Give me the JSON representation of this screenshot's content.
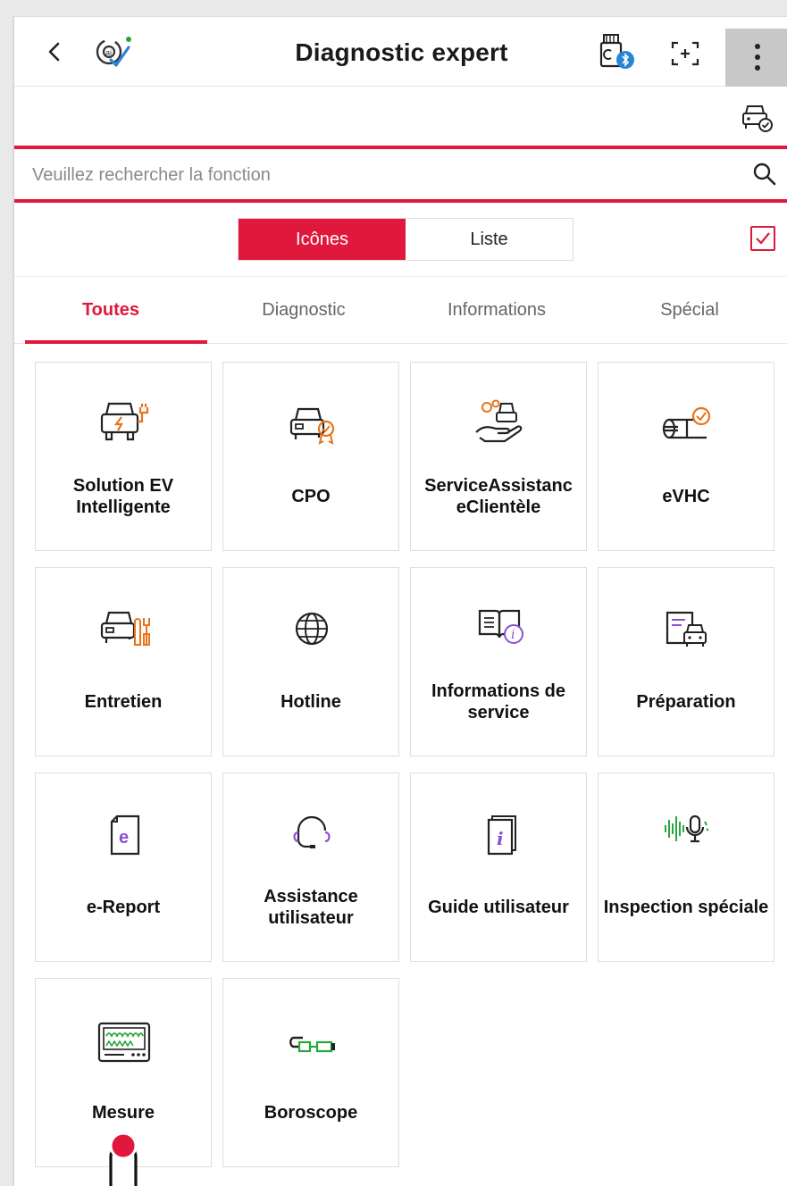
{
  "header": {
    "title": "Diagnostic expert",
    "icons": [
      "back-icon",
      "brand-logo-icon",
      "vci-bluetooth-icon",
      "scan-icon",
      "more-vertical-icon"
    ]
  },
  "vehicle_strip": {
    "icon": "vehicle-check-icon"
  },
  "search": {
    "placeholder": "Veuillez rechercher la fonction",
    "value": "",
    "icon": "search-icon"
  },
  "view_toggle": {
    "options": [
      "Icônes",
      "Liste"
    ],
    "selected": "Icônes"
  },
  "select_checkbox": {
    "checked": true
  },
  "filter_tabs": {
    "items": [
      "Toutes",
      "Diagnostic",
      "Informations",
      "Spécial"
    ],
    "selected": "Toutes"
  },
  "colors": {
    "accent": "#e0183b",
    "orange": "#e8731a",
    "purple": "#8a4fd3",
    "green": "#2aa63a"
  },
  "tiles": [
    {
      "label": "Solution EV Intelligente",
      "icon": "ev-car-charging-icon"
    },
    {
      "label": "CPO",
      "icon": "car-certified-icon"
    },
    {
      "label": "ServiceAssistanc eClientèle",
      "icon": "customer-service-hand-icon"
    },
    {
      "label": "eVHC",
      "icon": "vehicle-health-check-icon"
    },
    {
      "label": "Entretien",
      "icon": "car-maintenance-icon"
    },
    {
      "label": "Hotline",
      "icon": "globe-icon"
    },
    {
      "label": "Informations de service",
      "icon": "book-info-icon"
    },
    {
      "label": "Préparation",
      "icon": "document-car-icon"
    },
    {
      "label": "e-Report",
      "icon": "e-report-document-icon"
    },
    {
      "label": "Assistance utilisateur",
      "icon": "headset-icon"
    },
    {
      "label": "Guide utilisateur",
      "icon": "user-guide-book-icon"
    },
    {
      "label": "Inspection spéciale",
      "icon": "sound-wave-microphone-icon"
    },
    {
      "label": "Mesure",
      "icon": "oscilloscope-icon"
    },
    {
      "label": "Boroscope",
      "icon": "borescope-icon"
    }
  ]
}
